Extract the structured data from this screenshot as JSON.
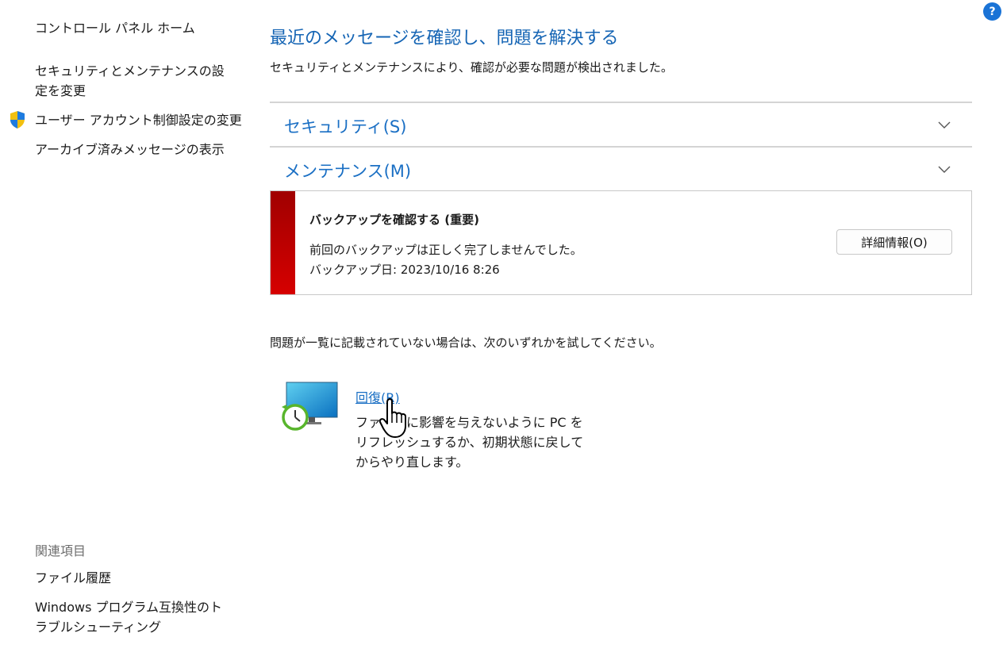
{
  "sidebar": {
    "home": "コントロール パネル ホーム",
    "security_settings": "セキュリティとメンテナンスの設定を変更",
    "uac_settings": "ユーザー アカウント制御設定の変更",
    "archived_messages": "アーカイブ済みメッセージの表示",
    "related_heading": "関連項目",
    "file_history": "ファイル履歴",
    "compat_troubleshoot": "Windows プログラム互換性のトラブルシューティング"
  },
  "main": {
    "title": "最近のメッセージを確認し、問題を解決する",
    "subtitle": "セキュリティとメンテナンスにより、確認が必要な問題が検出されました。",
    "security_section": "セキュリティ(S)",
    "maintenance_section": "メンテナンス(M)",
    "alert": {
      "title": "バックアップを確認する  (重要)",
      "line1": "前回のバックアップは正しく完了しませんでした。",
      "line2": "バックアップ日: 2023/10/16 8:26",
      "button": "詳細情報(O)",
      "severity_color": "#c00000"
    },
    "hint": "問題が一覧に記載されていない場合は、次のいずれかを試してください。",
    "recovery": {
      "link": "回復(R)",
      "description": "ファイルに影響を与えないように PC をリフレッシュするか、初期状態に戻してからやり直します。"
    }
  },
  "help": "?",
  "icons": [
    "shield-icon",
    "chevron-down-icon",
    "recovery-icon",
    "hand-cursor-icon",
    "help-icon"
  ],
  "colors": {
    "link": "#1a6fc4",
    "alert": "#c00000",
    "help": "#1a73d6"
  }
}
